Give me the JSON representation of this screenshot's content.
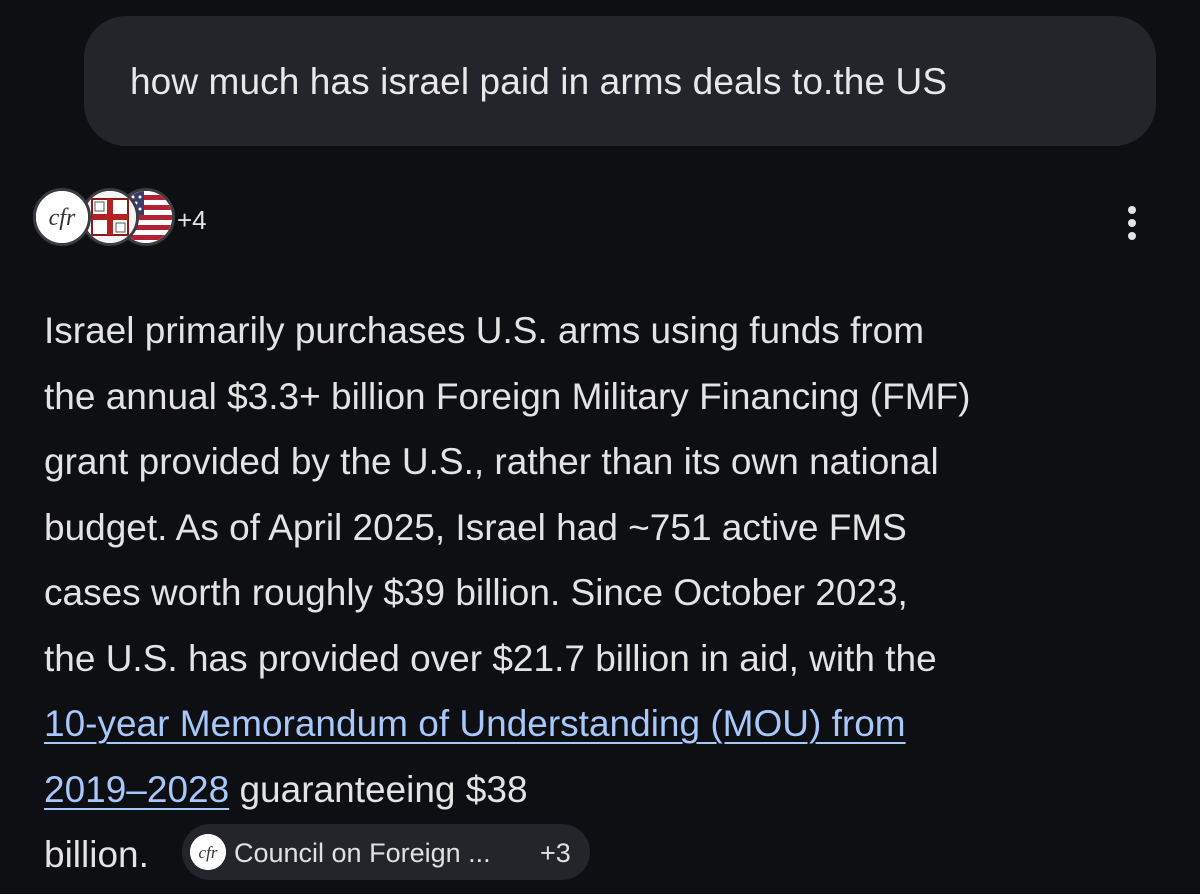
{
  "query": {
    "text": "how much has israel paid in arms deals to.the US"
  },
  "sources": {
    "favicons": [
      "cfr-logo-icon",
      "crest-icon",
      "us-flag-icon"
    ],
    "cfr_logo_text": "cfr",
    "more_count": "+4"
  },
  "answer": {
    "lines": [
      "Israel primarily purchases U.S. arms using funds from",
      "the annual $3.3+ billion Foreign Military Financing (FMF)",
      "grant provided by the U.S., rather than its own national",
      "budget. As of April 2025, Israel had ~751 active FMS",
      "cases worth roughly $39 billion. Since October 2023,",
      "the U.S. has provided over $21.7 billion in aid, with the"
    ],
    "link_line_1": "10-year Memorandum of Understanding (MOU) from",
    "link_line_2": "2019–2028",
    "after_link": " guaranteeing $38",
    "last_line": "billion. "
  },
  "source_chip": {
    "icon": "cfr-logo-icon",
    "icon_text": "cfr",
    "label": "Council on Foreign ...",
    "more": "+3"
  },
  "colors": {
    "background": "#0e0f12",
    "bubble": "#23252b",
    "text": "#e3e3e3",
    "link": "#a8c7fa"
  },
  "menu": {
    "icon": "more-vert-icon"
  }
}
